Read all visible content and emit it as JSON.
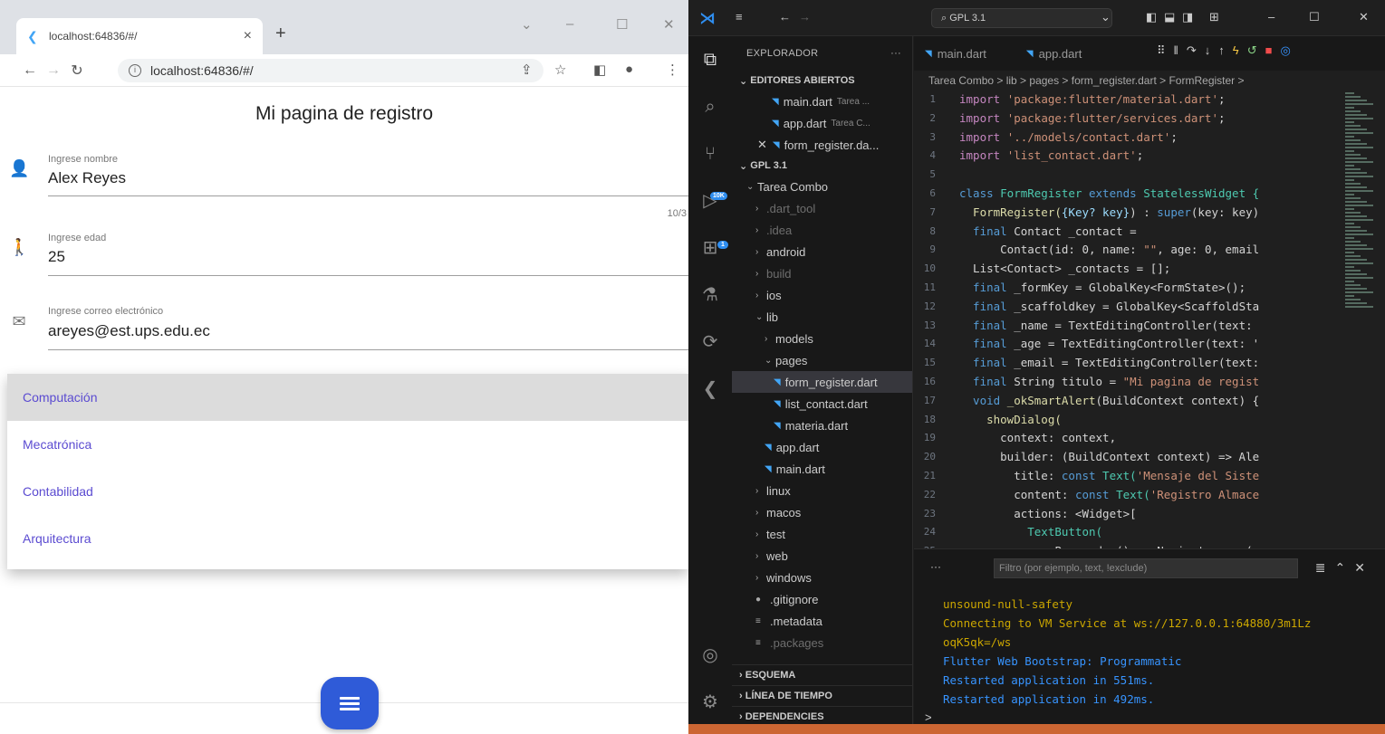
{
  "chrome": {
    "tab_title": "localhost:64836/#/",
    "tab_close": "×",
    "new_tab": "+",
    "url": "localhost:64836/#/"
  },
  "flutter": {
    "appbar_title": "Mi pagina de registro",
    "fields": [
      {
        "label": "Ingrese nombre",
        "value": "Alex Reyes",
        "counter": "10/3"
      },
      {
        "label": "Ingrese edad",
        "value": "25"
      },
      {
        "label": "Ingrese correo electrónico",
        "value": "areyes@est.ups.edu.ec"
      }
    ],
    "dropdown": [
      "Computación",
      "Mecatrónica",
      "Contabilidad",
      "Arquitectura"
    ],
    "selected_index": 0,
    "colors": {
      "accent": "#2f5bd8",
      "menu_text": "#5b4bd1"
    }
  },
  "vscode": {
    "command_center": "GPL 3.1",
    "explorer_title": "EXPLORADOR",
    "open_editors_title": "EDITORES ABIERTOS",
    "open_editors": [
      {
        "name": "main.dart",
        "sub": "Tarea ..."
      },
      {
        "name": "app.dart",
        "sub": "Tarea C..."
      },
      {
        "name": "form_register.da..."
      }
    ],
    "workspace_title": "GPL 3.1",
    "tree": [
      {
        "label": "Tarea Combo",
        "indent": 1,
        "chev": "v"
      },
      {
        "label": ".dart_tool",
        "indent": 2,
        "chev": ">",
        "dim": true
      },
      {
        "label": ".idea",
        "indent": 2,
        "chev": ">",
        "dim": true
      },
      {
        "label": "android",
        "indent": 2,
        "chev": ">"
      },
      {
        "label": "build",
        "indent": 2,
        "chev": ">",
        "dim": true
      },
      {
        "label": "ios",
        "indent": 2,
        "chev": ">"
      },
      {
        "label": "lib",
        "indent": 2,
        "chev": "v"
      },
      {
        "label": "models",
        "indent": 3,
        "chev": ">"
      },
      {
        "label": "pages",
        "indent": 3,
        "chev": "v"
      },
      {
        "label": "form_register.dart",
        "indent": 4,
        "file": true,
        "active": true
      },
      {
        "label": "list_contact.dart",
        "indent": 4,
        "file": true
      },
      {
        "label": "materia.dart",
        "indent": 4,
        "file": true
      },
      {
        "label": "app.dart",
        "indent": 3,
        "file": true
      },
      {
        "label": "main.dart",
        "indent": 3,
        "file": true
      },
      {
        "label": "linux",
        "indent": 2,
        "chev": ">"
      },
      {
        "label": "macos",
        "indent": 2,
        "chev": ">"
      },
      {
        "label": "test",
        "indent": 2,
        "chev": ">"
      },
      {
        "label": "web",
        "indent": 2,
        "chev": ">"
      },
      {
        "label": "windows",
        "indent": 2,
        "chev": ">"
      },
      {
        "label": ".gitignore",
        "indent": 2,
        "glyph": "●"
      },
      {
        "label": ".metadata",
        "indent": 2,
        "glyph": "≡"
      },
      {
        "label": ".packages",
        "indent": 2,
        "glyph": "≡",
        "dim": true
      }
    ],
    "sections": [
      "ESQUEMA",
      "LÍNEA DE TIEMPO",
      "DEPENDENCIES"
    ],
    "editor_tabs": [
      "main.dart",
      "app.dart"
    ],
    "breadcrumb": "Tarea Combo > lib > pages > form_register.dart > FormRegister >",
    "code": [
      [
        [
          "import ",
          "#c586c0"
        ],
        [
          "'package:flutter/material.dart'",
          "#ce9178"
        ],
        [
          ";",
          "#d4d4d4"
        ]
      ],
      [
        [
          "import ",
          "#c586c0"
        ],
        [
          "'package:flutter/services.dart'",
          "#ce9178"
        ],
        [
          ";",
          "#d4d4d4"
        ]
      ],
      [
        [
          "import ",
          "#c586c0"
        ],
        [
          "'../models/contact.dart'",
          "#ce9178"
        ],
        [
          ";",
          "#d4d4d4"
        ]
      ],
      [
        [
          "import ",
          "#c586c0"
        ],
        [
          "'list_contact.dart'",
          "#ce9178"
        ],
        [
          ";",
          "#d4d4d4"
        ]
      ],
      [],
      [
        [
          "class ",
          "#569cd6"
        ],
        [
          "FormRegister ",
          "#4ec9b0"
        ],
        [
          "extends ",
          "#569cd6"
        ],
        [
          "StatelessWidget {",
          "#4ec9b0"
        ]
      ],
      [
        [
          "  FormRegister(",
          "#dcdcaa"
        ],
        [
          "{Key? key}",
          "#9cdcfe"
        ],
        [
          ") : ",
          "#d4d4d4"
        ],
        [
          "super",
          "#569cd6"
        ],
        [
          "(key: key)",
          "#d4d4d4"
        ]
      ],
      [
        [
          "  final ",
          "#569cd6"
        ],
        [
          "Contact _contact =",
          "#d4d4d4"
        ]
      ],
      [
        [
          "      Contact(id: 0, name: ",
          "#d4d4d4"
        ],
        [
          "\"\"",
          "#ce9178"
        ],
        [
          ", age: 0, email",
          "#d4d4d4"
        ]
      ],
      [
        [
          "  List<Contact> _contacts = [];",
          "#d4d4d4"
        ]
      ],
      [
        [
          "  final ",
          "#569cd6"
        ],
        [
          "_formKey = GlobalKey<FormState>();",
          "#d4d4d4"
        ]
      ],
      [
        [
          "  final ",
          "#569cd6"
        ],
        [
          "_scaffoldkey = GlobalKey<ScaffoldSta",
          "#d4d4d4"
        ]
      ],
      [
        [
          "  final ",
          "#569cd6"
        ],
        [
          "_name = TextEditingController(text:",
          "#d4d4d4"
        ]
      ],
      [
        [
          "  final ",
          "#569cd6"
        ],
        [
          "_age = TextEditingController(text: '",
          "#d4d4d4"
        ]
      ],
      [
        [
          "  final ",
          "#569cd6"
        ],
        [
          "_email = TextEditingController(text:",
          "#d4d4d4"
        ]
      ],
      [
        [
          "  final ",
          "#569cd6"
        ],
        [
          "String titulo = ",
          "#d4d4d4"
        ],
        [
          "\"Mi pagina de regist",
          "#ce9178"
        ]
      ],
      [
        [
          "  void ",
          "#569cd6"
        ],
        [
          "_okSmartAlert",
          "#dcdcaa"
        ],
        [
          "(BuildContext context) {",
          "#d4d4d4"
        ]
      ],
      [
        [
          "    showDialog(",
          "#dcdcaa"
        ]
      ],
      [
        [
          "      context: context,",
          "#d4d4d4"
        ]
      ],
      [
        [
          "      builder: ",
          "#d4d4d4"
        ],
        [
          "(BuildContext context) => Ale",
          "#d4d4d4"
        ]
      ],
      [
        [
          "        title: ",
          "#d4d4d4"
        ],
        [
          "const ",
          "#569cd6"
        ],
        [
          "Text(",
          "#4ec9b0"
        ],
        [
          "'Mensaje del Siste",
          "#ce9178"
        ]
      ],
      [
        [
          "        content: ",
          "#d4d4d4"
        ],
        [
          "const ",
          "#569cd6"
        ],
        [
          "Text(",
          "#4ec9b0"
        ],
        [
          "'Registro Almace",
          "#ce9178"
        ]
      ],
      [
        [
          "        actions: <Widget>[",
          "#d4d4d4"
        ]
      ],
      [
        [
          "          TextButton(",
          "#4ec9b0"
        ]
      ],
      [
        [
          "            onPressed: () => Navigator.pop(c",
          "#d4d4d4"
        ]
      ]
    ],
    "filter_placeholder": "Filtro (por ejemplo, text, !exclude)",
    "output": [
      "unsound-null-safety",
      "Connecting to VM Service at ws://127.0.0.1:64880/3m1Lz",
      "oqK5qk=/ws",
      "Flutter Web Bootstrap: Programmatic",
      "Restarted application in 551ms.",
      "Restarted application in 492ms."
    ],
    "prompt": ">",
    "badges": {
      "source_control": "10K",
      "run": "1"
    },
    "colors": {
      "output_yellow": "#cca700",
      "output_blue": "#3794ff",
      "status": "#cc6633"
    }
  }
}
